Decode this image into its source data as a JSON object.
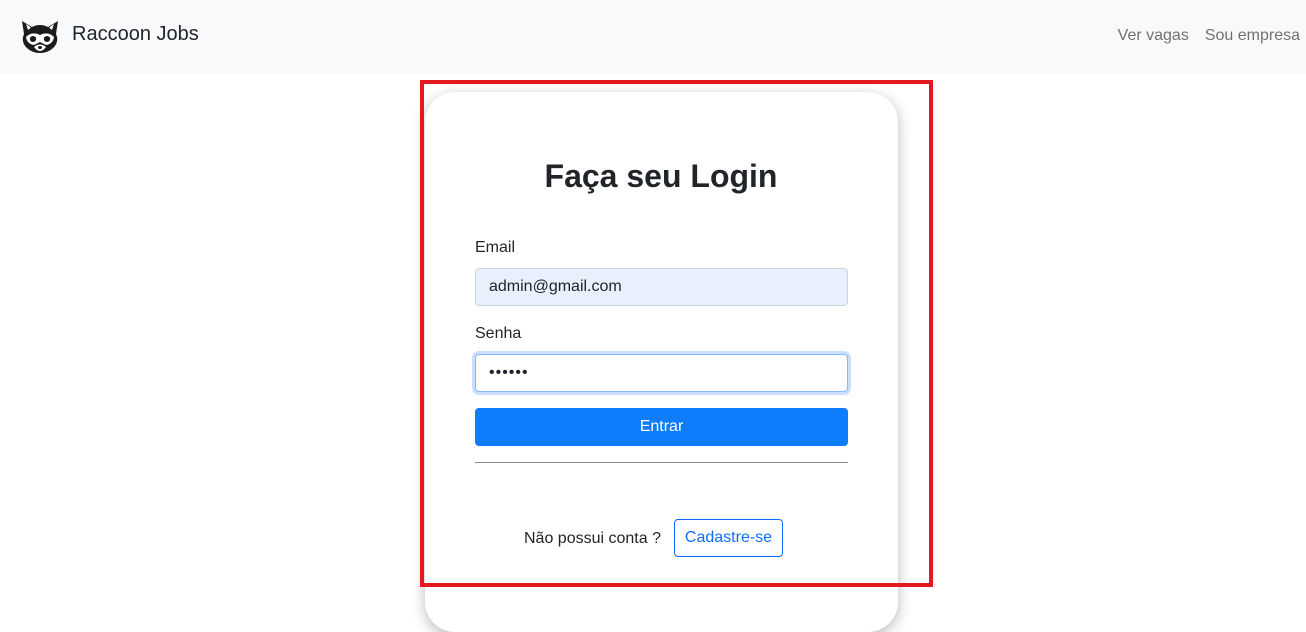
{
  "colors": {
    "accent": "#0d7cfd",
    "navbar_bg": "#f8f9fa",
    "highlight": "#e3191f"
  },
  "navbar": {
    "brand_icon": "raccoon-icon",
    "brand": "Raccoon Jobs",
    "links": [
      {
        "label": "Ver vagas"
      },
      {
        "label": "Sou empresa"
      }
    ]
  },
  "login": {
    "title": "Faça seu Login",
    "email_label": "Email",
    "email_value": "admin@gmail.com",
    "password_label": "Senha",
    "password_value": "••••••",
    "submit_label": "Entrar",
    "signup_prompt": "Não possui conta ?",
    "signup_label": "Cadastre-se"
  }
}
